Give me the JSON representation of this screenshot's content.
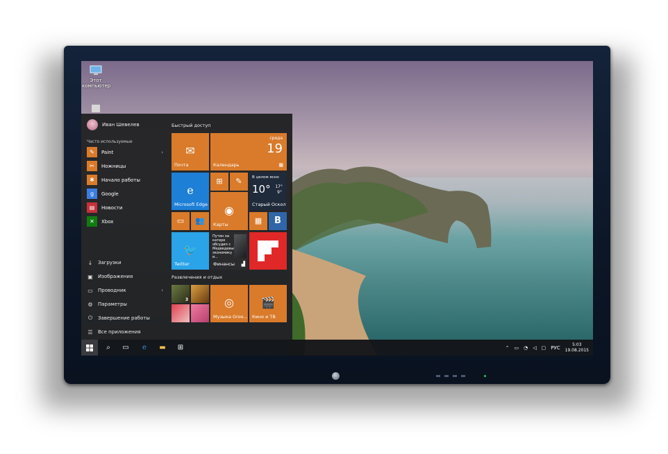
{
  "desktop": {
    "icons": [
      {
        "label": "Этот компьютер",
        "icon": "computer-icon"
      },
      {
        "label": "",
        "icon": "recycle-bin-icon"
      }
    ]
  },
  "start_menu": {
    "user_name": "Иван Шевелев",
    "frequent_label": "Часто используемые",
    "apps": [
      {
        "label": "Paint",
        "icon": "paint-icon",
        "color": "#d97b2b",
        "has_submenu": true
      },
      {
        "label": "Ножницы",
        "icon": "scissors-icon",
        "color": "#d97b2b",
        "has_submenu": false
      },
      {
        "label": "Начало работы",
        "icon": "lightbulb-icon",
        "color": "#d97b2b",
        "has_submenu": false
      },
      {
        "label": "Google",
        "icon": "google-icon",
        "color": "#3b7de0",
        "has_submenu": false
      },
      {
        "label": "Новости",
        "icon": "news-icon",
        "color": "#c4313a",
        "has_submenu": false
      },
      {
        "label": "Xbox",
        "icon": "xbox-icon",
        "color": "#107c10",
        "has_submenu": false
      }
    ],
    "system": [
      {
        "label": "Загрузки",
        "icon": "download-icon"
      },
      {
        "label": "Изображения",
        "icon": "pictures-icon"
      },
      {
        "label": "Проводник",
        "icon": "folder-icon",
        "has_submenu": true
      },
      {
        "label": "Параметры",
        "icon": "gear-icon"
      },
      {
        "label": "Завершение работы",
        "icon": "power-icon"
      },
      {
        "label": "Все приложения",
        "icon": "list-icon"
      }
    ],
    "quick_access_label": "Быстрый доступ",
    "entertainment_label": "Развлечения и отдых",
    "tiles": {
      "mail": "Почта",
      "calendar": "Календарь",
      "calendar_day_name": "среда",
      "calendar_day": "19",
      "edge": "Microsoft Edge",
      "weather_desc": "В целом ясно",
      "weather_temp": "10°",
      "weather_hi": "17°",
      "weather_lo": "9°",
      "weather_city": "Старый Оскол",
      "maps": "Карты",
      "finance_text": "Путин на катере обсудил с Медведевым экономику и...",
      "finance": "Финансы",
      "twitter": "Twitter",
      "music": "Музыка Groo...",
      "movies": "Кино и ТВ",
      "game_badge": "3"
    }
  },
  "taskbar": {
    "language": "РУС",
    "time": "5:03",
    "date": "19.08.2015"
  }
}
